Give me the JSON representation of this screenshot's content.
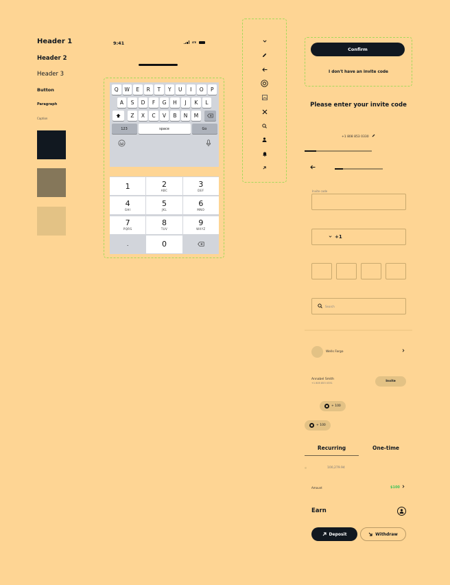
{
  "typography": {
    "header1": "Header 1",
    "header2": "Header 2",
    "header3": "Header 3",
    "button": "Button",
    "paragraph": "Paragraph",
    "caption": "Caption"
  },
  "colors": {
    "background": "#fed594",
    "primary": "#111820",
    "secondary": "#85775a",
    "tertiary": "#e3c285",
    "success": "#41c35a"
  },
  "status_bar": {
    "time": "9:41",
    "network": "LTE"
  },
  "keyboard": {
    "row1": [
      "Q",
      "W",
      "E",
      "R",
      "T",
      "Y",
      "U",
      "I",
      "O",
      "P"
    ],
    "row2": [
      "A",
      "S",
      "D",
      "F",
      "G",
      "H",
      "J",
      "K",
      "L"
    ],
    "row3": [
      "Z",
      "X",
      "C",
      "V",
      "B",
      "N",
      "M"
    ],
    "numbers_key": "123",
    "space_key": "space",
    "go_key": "Go"
  },
  "numpad": {
    "keys": [
      {
        "num": "1",
        "letters": ""
      },
      {
        "num": "2",
        "letters": "ABC"
      },
      {
        "num": "3",
        "letters": "DEF"
      },
      {
        "num": "4",
        "letters": "GHI"
      },
      {
        "num": "5",
        "letters": "JKL"
      },
      {
        "num": "6",
        "letters": "MNO"
      },
      {
        "num": "7",
        "letters": "PQRS"
      },
      {
        "num": "8",
        "letters": "TUV"
      },
      {
        "num": "9",
        "letters": "WXYZ"
      }
    ],
    "dot": ".",
    "zero": "0"
  },
  "icons": [
    "chevron-down-icon",
    "pencil-icon",
    "arrow-left-icon",
    "coin-icon",
    "image-icon",
    "close-icon",
    "search-icon",
    "user-icon",
    "bell-icon",
    "arrow-up-right-icon"
  ],
  "actions": {
    "confirm": "Confirm",
    "no_invite": "I don't have an invite code"
  },
  "invite": {
    "title": "Please enter your invite code",
    "phone": "+1 808 853 0330",
    "progress": 0.17,
    "step_progress": 0.17,
    "field_label": "Invite code",
    "field_value": "",
    "country_code": "+1",
    "search_placeholder": "Search"
  },
  "bank": {
    "name": "Wells Fargo"
  },
  "contact": {
    "name": "Annabel Smith",
    "phone": "+1 805 853 0331",
    "invite_label": "Invite"
  },
  "chips": [
    "+ 100",
    "+ 100"
  ],
  "tabs": {
    "recurring": "Recurring",
    "one_time": "One-time",
    "active": "Recurring"
  },
  "list": {
    "value": "100,279.94"
  },
  "amount": {
    "label": "Amount",
    "value": "$100"
  },
  "earn": {
    "title": "Earn",
    "deposit": "Deposit",
    "withdraw": "Withdraw"
  }
}
